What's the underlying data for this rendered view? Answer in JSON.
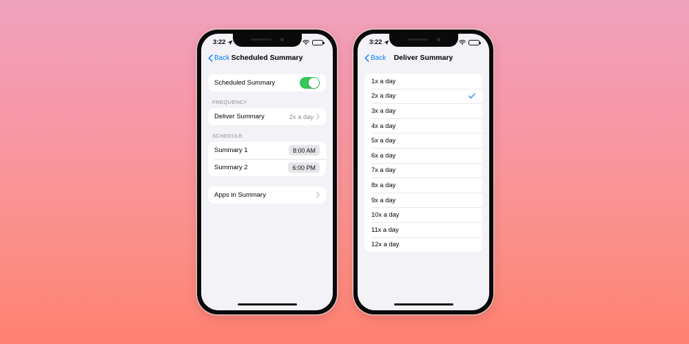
{
  "background": {
    "gradient_top": "#efa2bd",
    "gradient_bottom": "#ff8071"
  },
  "accent": {
    "blue": "#0a7cff",
    "green": "#34c759",
    "gray_text": "#8a8a8f"
  },
  "phones": [
    {
      "status_bar": {
        "time": "3:22",
        "location_icon": "location-arrow-icon",
        "wifi_icon": "wifi-icon",
        "battery_icon": "battery-icon"
      },
      "nav": {
        "back_label": "Back",
        "title": "Scheduled Summary"
      },
      "sections": [
        {
          "header": "",
          "rows": [
            {
              "label": "Scheduled Summary",
              "control": "toggle",
              "toggle_on": true
            }
          ]
        },
        {
          "header": "FREQUENCY",
          "rows": [
            {
              "label": "Deliver Summary",
              "value": "2x a day",
              "control": "chevron"
            }
          ]
        },
        {
          "header": "SCHEDULE",
          "rows": [
            {
              "label": "Summary 1",
              "value": "8:00 AM",
              "control": "pill"
            },
            {
              "label": "Summary 2",
              "value": "6:00 PM",
              "control": "pill"
            }
          ]
        },
        {
          "header": "",
          "rows": [
            {
              "label": "Apps in Summary",
              "value": "",
              "control": "chevron"
            }
          ]
        }
      ]
    },
    {
      "status_bar": {
        "time": "3:22",
        "location_icon": "location-arrow-icon",
        "wifi_icon": "wifi-icon",
        "battery_icon": "battery-icon"
      },
      "nav": {
        "back_label": "Back",
        "title": "Deliver Summary"
      },
      "options": [
        {
          "label": "1x a day",
          "selected": false
        },
        {
          "label": "2x a day",
          "selected": true
        },
        {
          "label": "3x a day",
          "selected": false
        },
        {
          "label": "4x a day",
          "selected": false
        },
        {
          "label": "5x a day",
          "selected": false
        },
        {
          "label": "6x a day",
          "selected": false
        },
        {
          "label": "7x a day",
          "selected": false
        },
        {
          "label": "8x a day",
          "selected": false
        },
        {
          "label": "9x a day",
          "selected": false
        },
        {
          "label": "10x a day",
          "selected": false
        },
        {
          "label": "11x a day",
          "selected": false
        },
        {
          "label": "12x a day",
          "selected": false
        }
      ]
    }
  ]
}
